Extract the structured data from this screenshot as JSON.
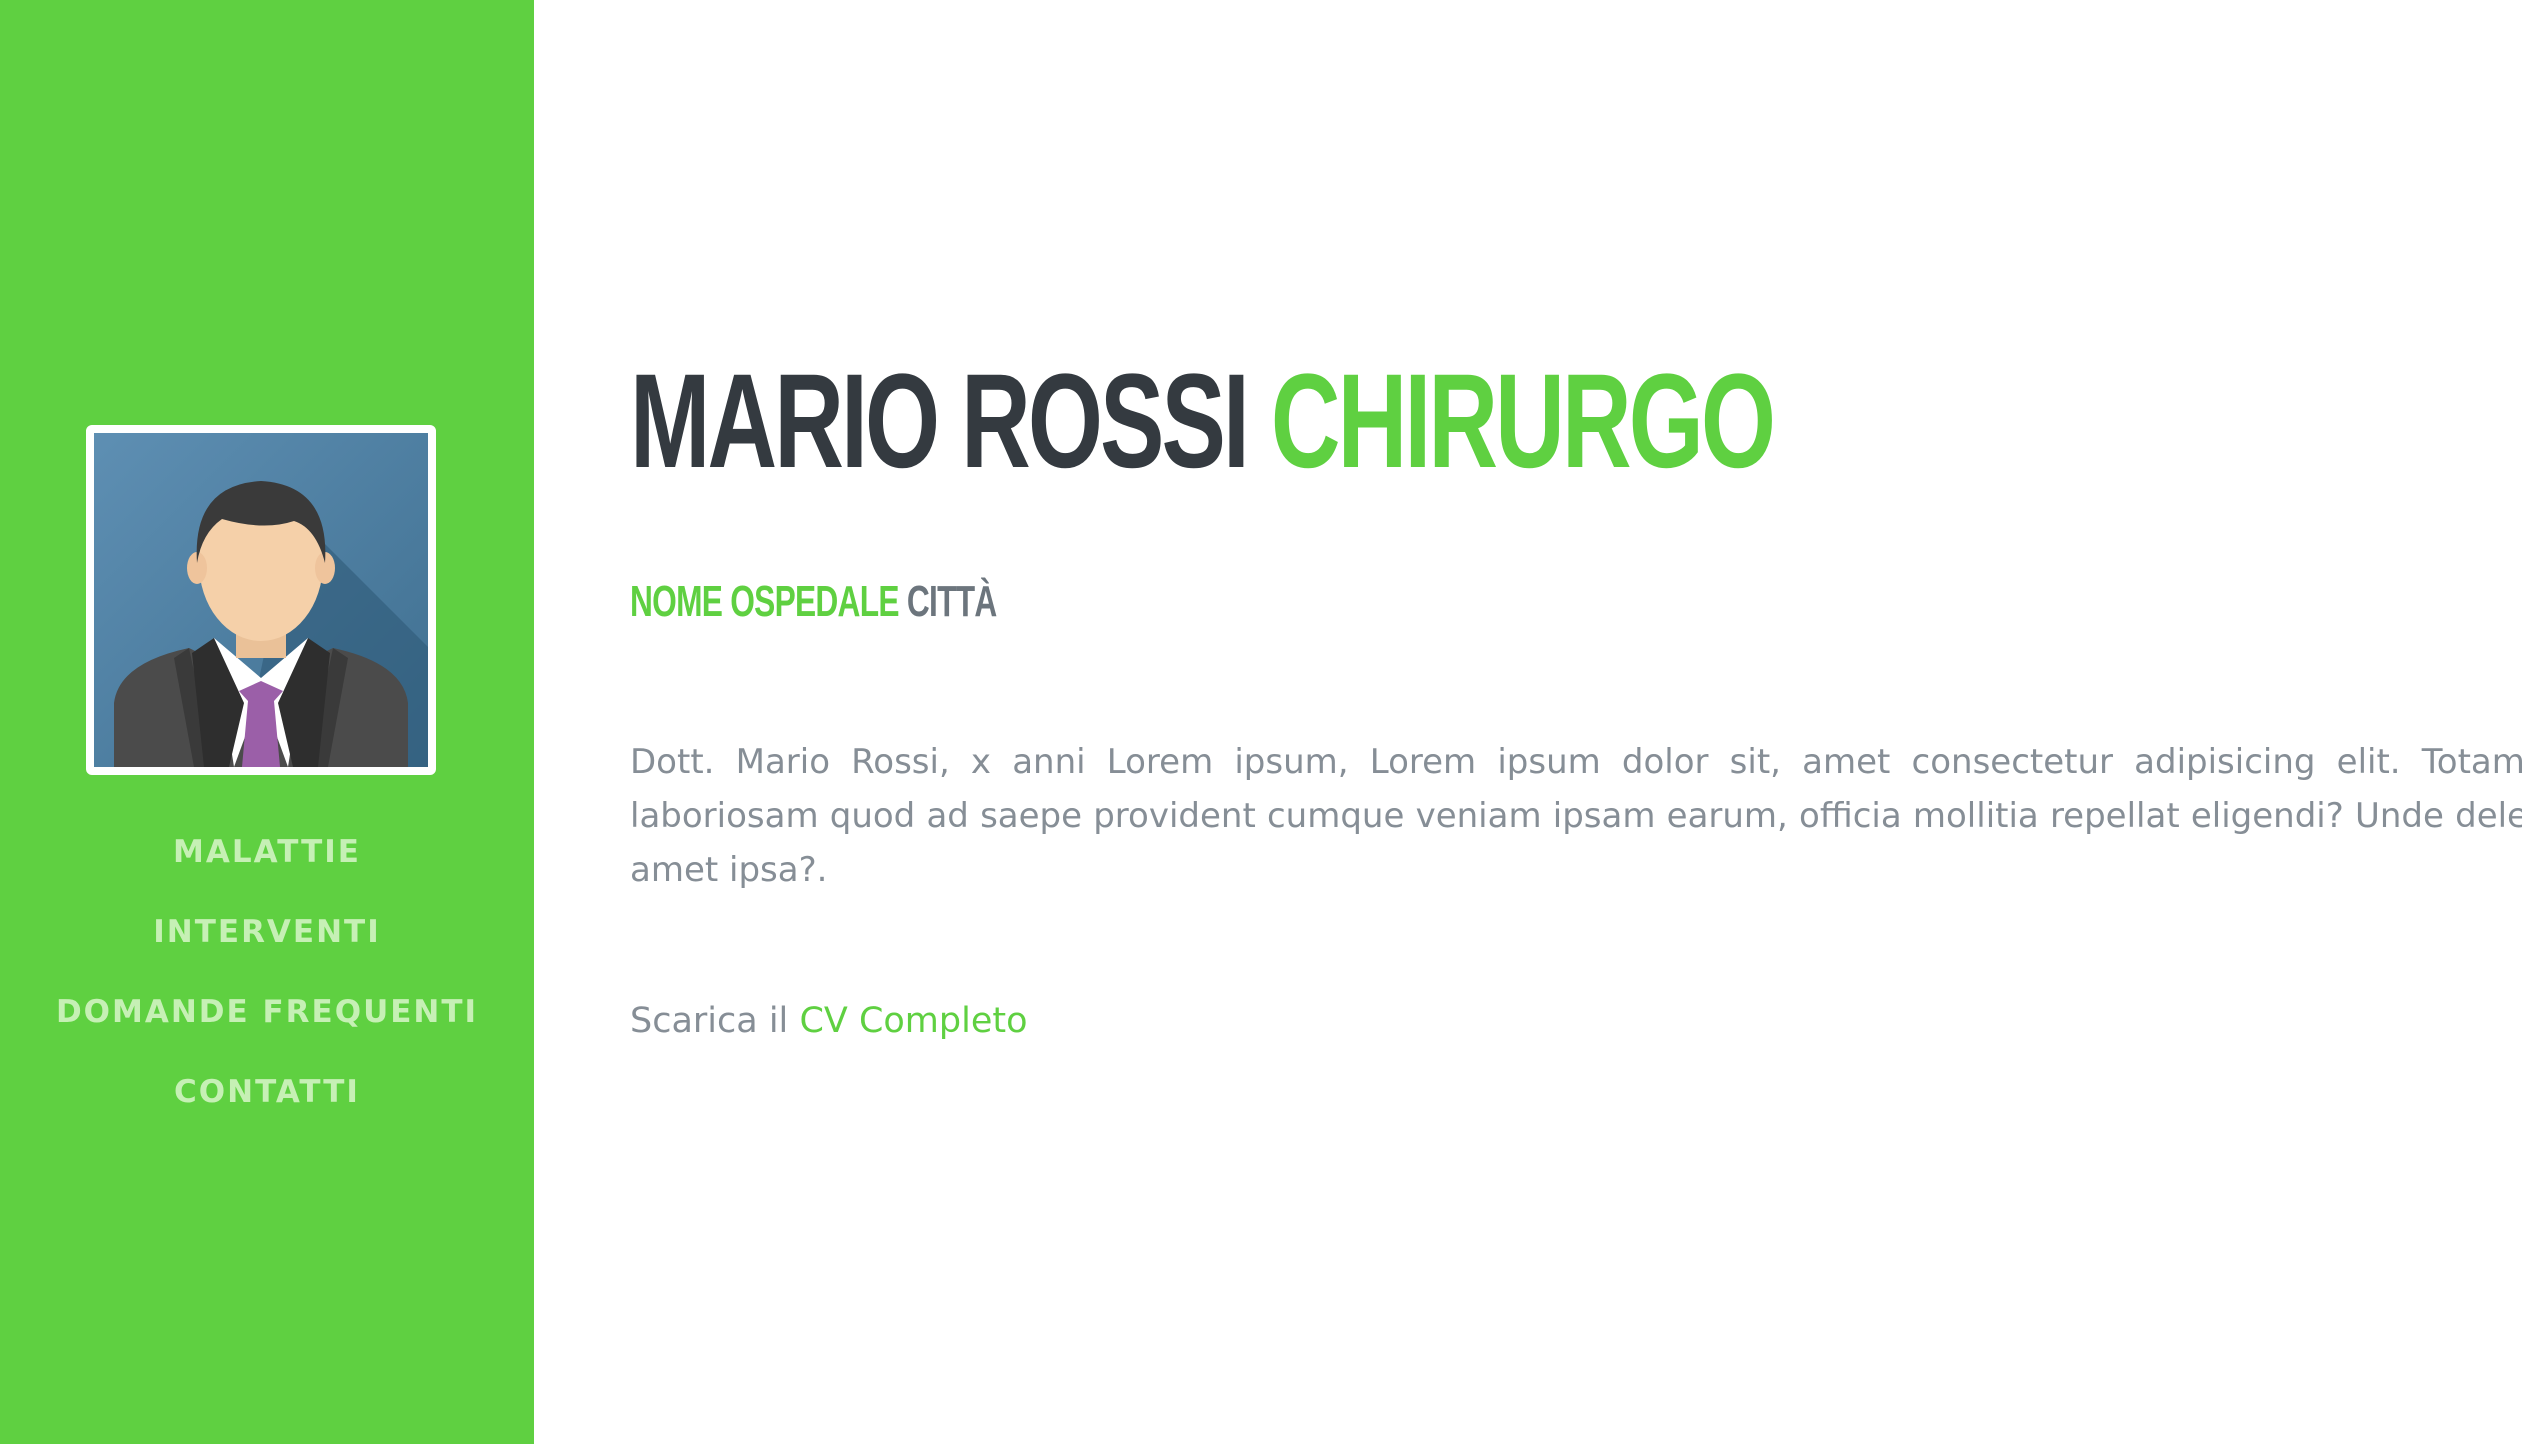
{
  "colors": {
    "sidebar_bg": "#5fd041",
    "accent": "#5fd041",
    "heading": "#343a40",
    "muted_text": "#868e96",
    "nav_text": "#c6f0b5"
  },
  "sidebar": {
    "avatar_icon": "doctor-avatar-icon",
    "nav": [
      {
        "label": "MALATTIE"
      },
      {
        "label": "INTERVENTI"
      },
      {
        "label": "DOMANDE FREQUENTI"
      },
      {
        "label": "CONTATTI"
      }
    ]
  },
  "main": {
    "title_name": "MARIO ROSSI",
    "title_role": "CHIRURGO",
    "hospital": "NOME OSPEDALE",
    "city": "CITTÀ",
    "bio": "Dott. Mario Rossi, x anni Lorem ipsum, Lorem ipsum dolor sit, amet consectetur adipisicing elit. Totam r laboriosam quod ad saepe provident cumque veniam ipsam earum, officia mollitia repellat eligendi? Unde delect amet ipsa?.",
    "cv_prefix": "Scarica il",
    "cv_link": "CV Completo"
  }
}
